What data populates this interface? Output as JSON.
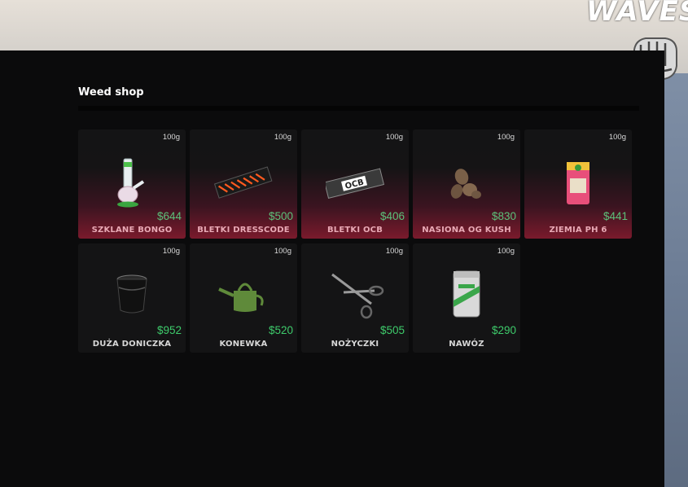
{
  "brand": "WAVES",
  "shop": {
    "title": "Weed shop",
    "items": [
      {
        "name": "SZKLANE BONGO",
        "price": "$644",
        "weight": "100g",
        "icon": "bong-icon",
        "highlighted": true
      },
      {
        "name": "BLETKI DRESSCODE",
        "price": "$500",
        "weight": "100g",
        "icon": "rolling-papers-dresscode-icon",
        "highlighted": true
      },
      {
        "name": "BLETKI OCB",
        "price": "$406",
        "weight": "100g",
        "icon": "rolling-papers-ocb-icon",
        "highlighted": true,
        "ocb_text": "OCB"
      },
      {
        "name": "NASIONA OG KUSH",
        "price": "$830",
        "weight": "100g",
        "icon": "seeds-icon",
        "highlighted": true
      },
      {
        "name": "ZIEMIA PH 6",
        "price": "$441",
        "weight": "100g",
        "icon": "soil-bag-icon",
        "highlighted": true
      },
      {
        "name": "DUŻA DONICZKA",
        "price": "$952",
        "weight": "100g",
        "icon": "pot-icon",
        "highlighted": false
      },
      {
        "name": "KONEWKA",
        "price": "$520",
        "weight": "100g",
        "icon": "watering-can-icon",
        "highlighted": false
      },
      {
        "name": "NOŻYCZKI",
        "price": "$505",
        "weight": "100g",
        "icon": "scissors-icon",
        "highlighted": false
      },
      {
        "name": "NAWÓZ",
        "price": "$290",
        "weight": "100g",
        "icon": "fertilizer-can-icon",
        "highlighted": false
      }
    ]
  },
  "colors": {
    "panel": "#0b0b0c",
    "card": "#141415",
    "highlight": "#7a1a2c",
    "price": "#3ecb6b"
  }
}
